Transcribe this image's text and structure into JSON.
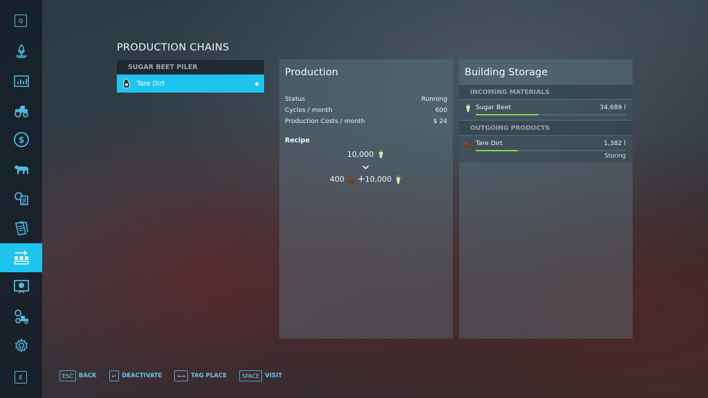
{
  "sidebar": {
    "top_key": "Q",
    "bottom_key": "E",
    "items": [
      {
        "icon": "crops-icon",
        "active": false
      },
      {
        "icon": "statistics-icon",
        "active": false
      },
      {
        "icon": "vehicles-icon",
        "active": false
      },
      {
        "icon": "finances-icon",
        "active": false
      },
      {
        "icon": "animals-icon",
        "active": false
      },
      {
        "icon": "contracts-icon",
        "active": false
      },
      {
        "icon": "documents-icon",
        "active": false
      },
      {
        "icon": "production-chains-icon",
        "active": true
      },
      {
        "icon": "help-icon",
        "active": false
      },
      {
        "icon": "garage-icon",
        "active": false
      },
      {
        "icon": "settings-icon",
        "active": false
      }
    ]
  },
  "page": {
    "title": "PRODUCTION CHAINS"
  },
  "chains": {
    "header": "SUGAR BEET PILER",
    "items": [
      {
        "label": "Tare Dirt",
        "selected": true
      }
    ]
  },
  "production": {
    "title": "Production",
    "rows": [
      {
        "label": "Status",
        "value": "Running"
      },
      {
        "label": "Cycles / month",
        "value": "600"
      },
      {
        "label": "Production Costs / month",
        "value": "$ 24"
      }
    ],
    "recipe_label": "Recipe",
    "recipe_input": "10,000",
    "recipe_output_a": "400",
    "recipe_plus": "+",
    "recipe_output_b": "10,000"
  },
  "storage": {
    "title": "Building Storage",
    "incoming_header": "INCOMING MATERIALS",
    "incoming": [
      {
        "name": "Sugar Beet",
        "amount": "34,689 l",
        "fill": 0.42,
        "icon": "sugar-beet-icon"
      }
    ],
    "outgoing_header": "OUTGOING PRODUCTS",
    "outgoing": [
      {
        "name": "Tare Dirt",
        "amount": "1,382 l",
        "fill": 0.28,
        "status": "Storing",
        "icon": "tare-dirt-icon"
      }
    ],
    "bar_color": "#7bd84a"
  },
  "hints": [
    {
      "key": "ESC",
      "label": "BACK"
    },
    {
      "key": "↵",
      "label": "DEACTIVATE"
    },
    {
      "key": "⟷",
      "label": "TAG PLACE"
    },
    {
      "key": "SPACE",
      "label": "VISIT"
    }
  ],
  "colors": {
    "accent": "#1ec4ee",
    "sidebar_bg": "#121c26"
  }
}
